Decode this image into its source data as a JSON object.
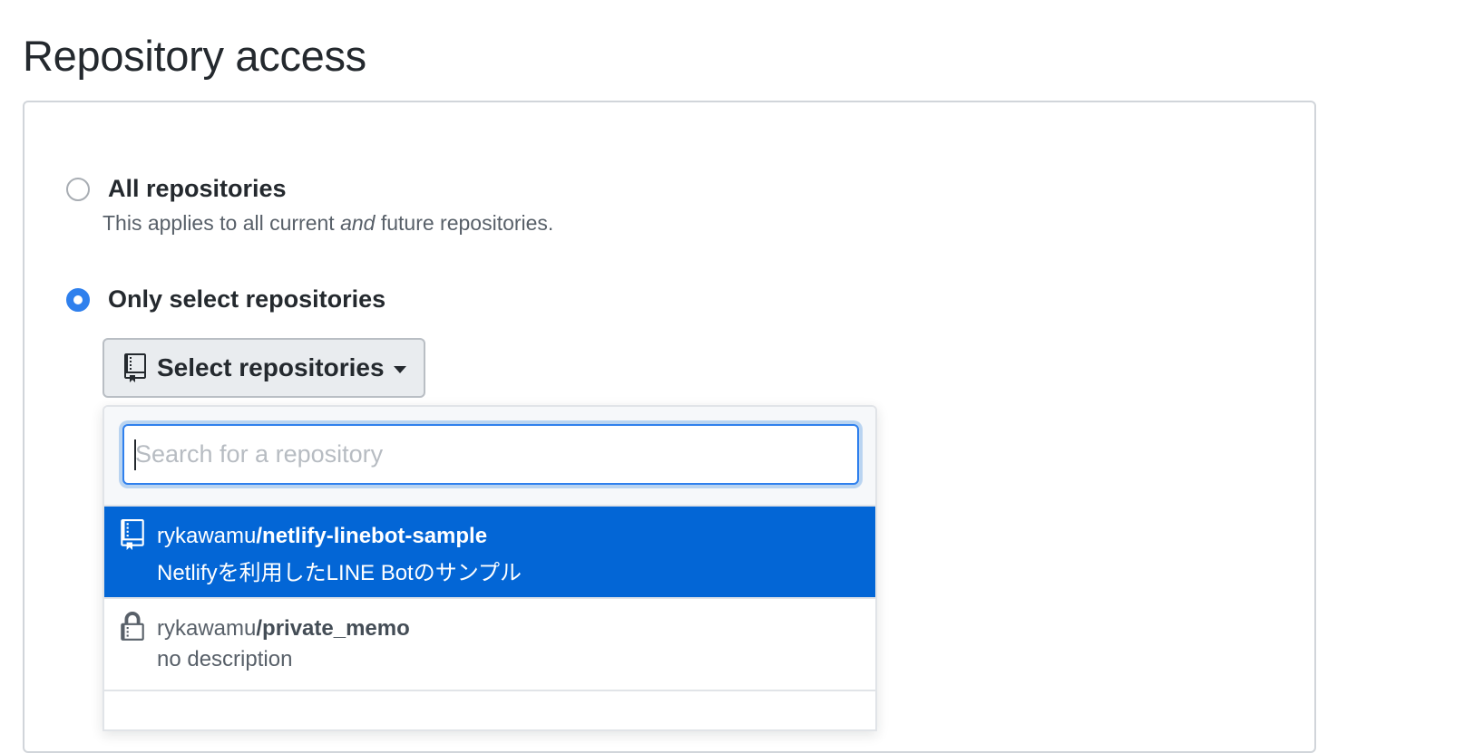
{
  "page": {
    "title": "Repository access"
  },
  "options": {
    "all": {
      "label": "All repositories",
      "note_prefix": "This applies to all current ",
      "note_emphasis": "and",
      "note_suffix": " future repositories.",
      "checked": false
    },
    "select": {
      "label": "Only select repositories",
      "checked": true
    }
  },
  "select_button": {
    "label": "Select repositories",
    "icon": "repo-icon"
  },
  "dropdown": {
    "search": {
      "placeholder": "Search for a repository",
      "value": ""
    },
    "items": [
      {
        "owner": "rykawamu",
        "separator": "/",
        "name": "netlify-linebot-sample",
        "description": "Netlifyを利用したLINE Botのサンプル",
        "icon": "repo-icon",
        "active": true
      },
      {
        "owner": "rykawamu",
        "separator": "/",
        "name": "private_memo",
        "description": "no description",
        "icon": "lock-icon",
        "active": false
      }
    ]
  },
  "colors": {
    "accent": "#0366d6",
    "radio_checked": "#2f80ed",
    "text": "#24292e",
    "muted": "#586069"
  }
}
